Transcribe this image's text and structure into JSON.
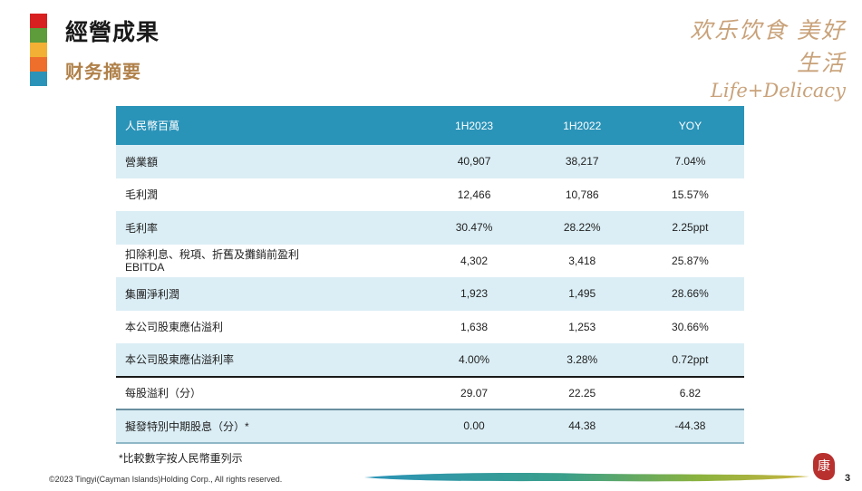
{
  "header": {
    "title": "經營成果",
    "subtitle": "财务摘要",
    "brand_cn": "欢乐饮食 美好生活",
    "brand_en": "Life+Delicacy",
    "color_bar": [
      "#d7201f",
      "#5d9b3b",
      "#f2b134",
      "#ee6f2b",
      "#2b93b7"
    ]
  },
  "table": {
    "headers": [
      "人民幣百萬",
      "1H2023",
      "1H2022",
      "YOY"
    ],
    "rows": [
      {
        "label": "營業額",
        "h2023": "40,907",
        "h2022": "38,217",
        "yoy": "7.04%"
      },
      {
        "label": "毛利潤",
        "h2023": "12,466",
        "h2022": "10,786",
        "yoy": "15.57%"
      },
      {
        "label": "毛利率",
        "h2023": "30.47%",
        "h2022": "28.22%",
        "yoy": "2.25ppt"
      },
      {
        "label": "扣除利息、稅項、折舊及攤銷前盈利",
        "label2": "EBITDA",
        "h2023": "4,302",
        "h2022": "3,418",
        "yoy": "25.87%"
      },
      {
        "label": "集團淨利潤",
        "h2023": "1,923",
        "h2022": "1,495",
        "yoy": "28.66%"
      },
      {
        "label": "本公司股東應佔溢利",
        "h2023": "1,638",
        "h2022": "1,253",
        "yoy": "30.66%"
      },
      {
        "label": "本公司股東應佔溢利率",
        "h2023": "4.00%",
        "h2022": "3.28%",
        "yoy": "0.72ppt"
      },
      {
        "label": "每股溢利（分）",
        "h2023": "29.07",
        "h2022": "22.25",
        "yoy": "6.82"
      },
      {
        "label": "擬發特別中期股息（分）*",
        "h2023": "0.00",
        "h2022": "44.38",
        "yoy": "-44.38"
      }
    ]
  },
  "footnote": "*比較數字按人民幣重列示",
  "copyright": "©2023 Tingyi(Cayman Islands)Holding Corp., All rights reserved.",
  "seal_char": "康",
  "page_number": "3"
}
